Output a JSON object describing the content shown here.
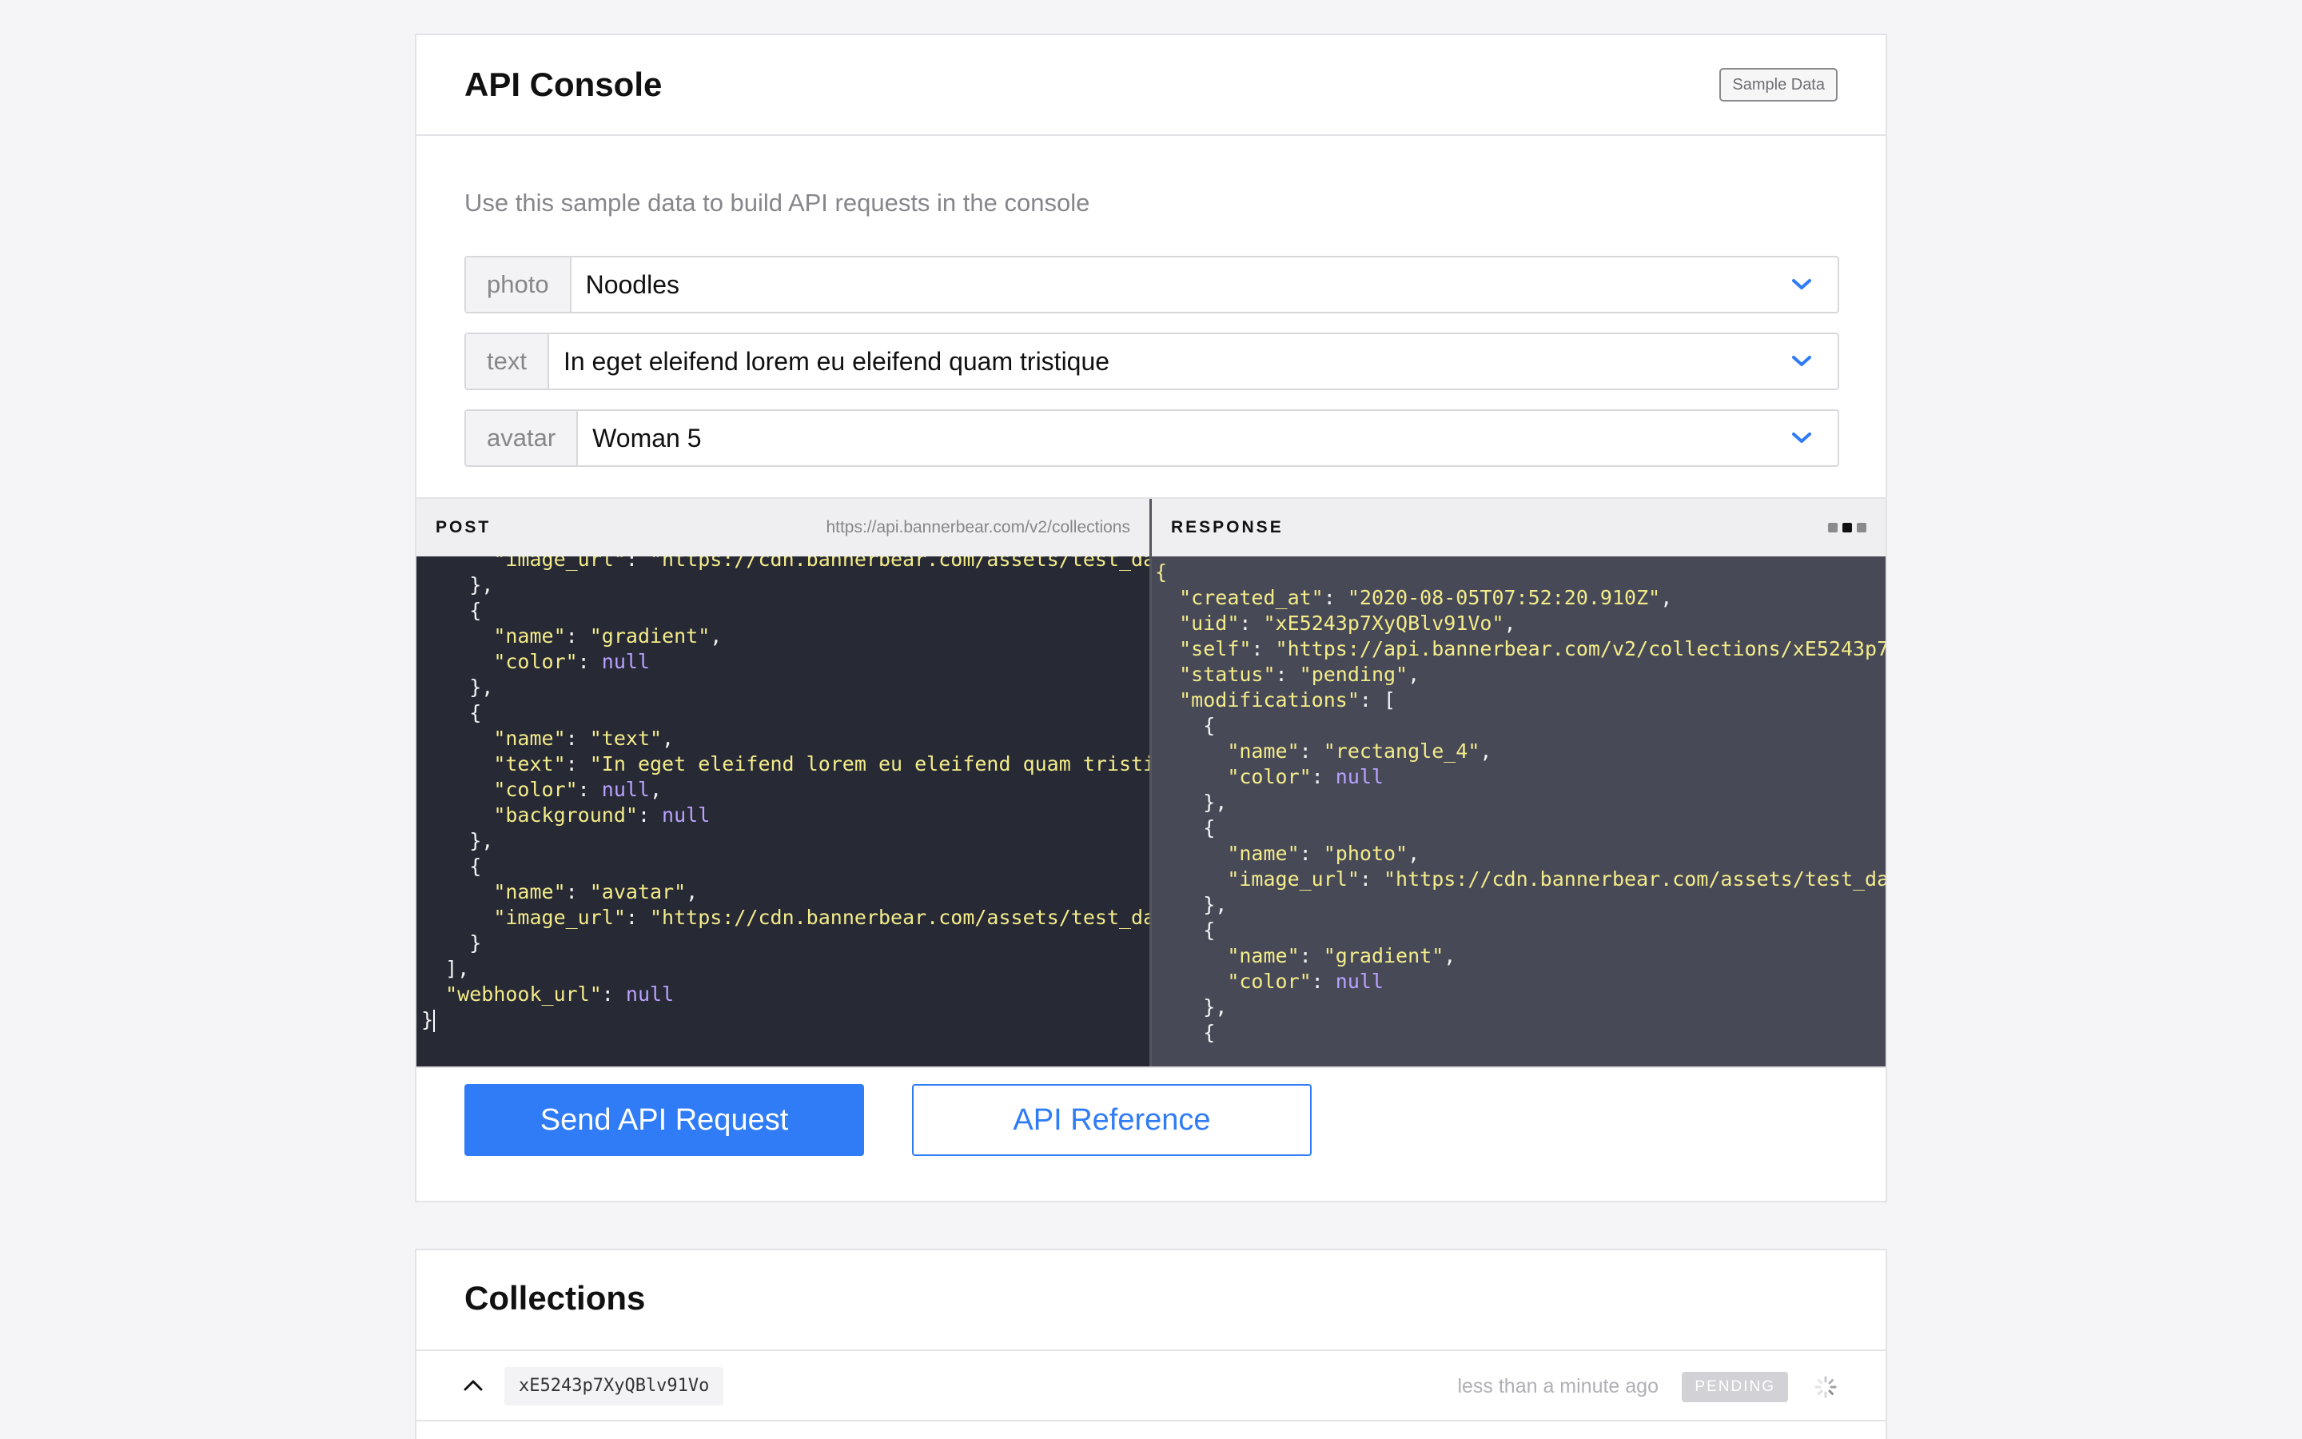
{
  "console": {
    "title": "API Console",
    "sample_data_label": "Sample Data",
    "intro": "Use this sample data to build API requests in the console",
    "fields": [
      {
        "label": "photo",
        "value": "Noodles"
      },
      {
        "label": "text",
        "value": "In eget eleifend lorem eu eleifend quam tristique"
      },
      {
        "label": "avatar",
        "value": "Woman 5"
      }
    ],
    "post": {
      "title": "POST",
      "url": "https://api.bannerbear.com/v2/collections"
    },
    "response": {
      "title": "RESPONSE"
    },
    "send_label": "Send API Request",
    "reference_label": "API Reference"
  },
  "collections": {
    "title": "Collections",
    "rows": [
      {
        "uid": "xE5243p7XyQBlv91Vo",
        "time": "less than a minute ago",
        "status": "PENDING"
      }
    ]
  },
  "colors": {
    "accent": "#2f7cf6",
    "code_bg": "#272935",
    "response_bg": "#474957",
    "string": "#f3ec8a",
    "null": "#b9a2ff"
  },
  "icons": [
    "chevron-down-icon",
    "chevron-up-icon",
    "spinner-icon",
    "panel-toggle-dots-icon"
  ]
}
